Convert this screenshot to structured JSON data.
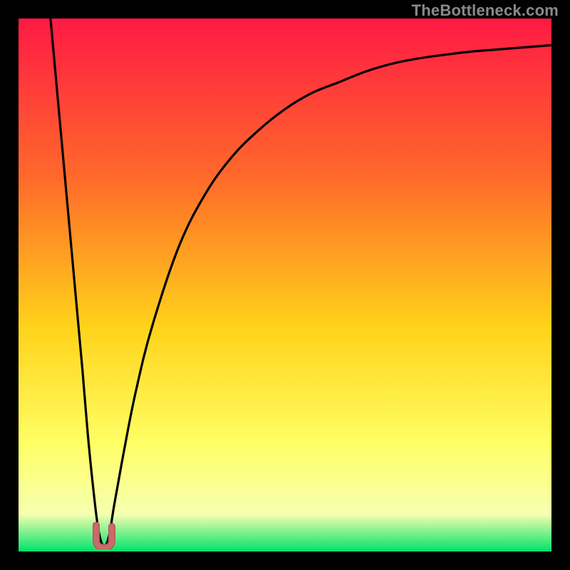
{
  "watermark": "TheBottleneck.com",
  "colors": {
    "background": "#000000",
    "grad_top": "#ff1a44",
    "grad_mid1": "#ff6a2a",
    "grad_mid2": "#ffd31a",
    "grad_mid3": "#ffff66",
    "grad_low": "#f6ffb0",
    "grad_bottom": "#00e26a",
    "curve": "#000000",
    "marker_fill": "#cc6a6a",
    "marker_stroke": "#b35a5a"
  },
  "chart_data": {
    "type": "line",
    "title": "",
    "xlabel": "",
    "ylabel": "",
    "xlim": [
      0,
      100
    ],
    "ylim": [
      0,
      100
    ],
    "series": [
      {
        "name": "bottleneck-curve",
        "x": [
          6,
          8,
          10,
          12,
          13,
          14,
          15,
          16,
          17,
          18,
          20,
          22,
          25,
          30,
          35,
          40,
          45,
          50,
          55,
          60,
          65,
          70,
          75,
          80,
          85,
          90,
          95,
          100
        ],
        "y": [
          100,
          78,
          56,
          34,
          22,
          12,
          4,
          1,
          3,
          9,
          20,
          30,
          42,
          57,
          67,
          74,
          79,
          83,
          86,
          88,
          90,
          91.5,
          92.5,
          93.2,
          93.8,
          94.2,
          94.6,
          95
        ]
      }
    ],
    "optimum": {
      "x": 16,
      "y": 1
    },
    "gradient_stops": [
      {
        "offset": 0.0,
        "color": "#ff1a44"
      },
      {
        "offset": 0.3,
        "color": "#ff6a2a"
      },
      {
        "offset": 0.58,
        "color": "#ffd31a"
      },
      {
        "offset": 0.8,
        "color": "#ffff66"
      },
      {
        "offset": 0.93,
        "color": "#f6ffb0"
      },
      {
        "offset": 1.0,
        "color": "#00e26a"
      }
    ]
  }
}
